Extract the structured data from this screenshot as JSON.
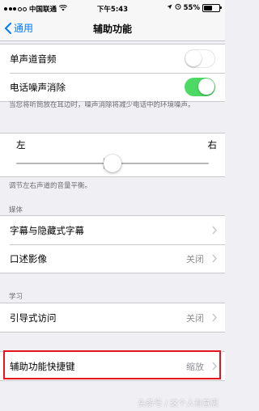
{
  "status_bar": {
    "carrier": "中国联通",
    "time": "下午5:43",
    "battery": "55%",
    "battery_level": 0.55,
    "icons": [
      "signal-dots-icon",
      "wifi-icon",
      "location-icon",
      "alarm-icon",
      "battery-icon"
    ]
  },
  "nav": {
    "back_label": "通用",
    "title": "辅助功能"
  },
  "audio_group": {
    "mono_audio_label": "单声道音频",
    "mono_audio_on": false,
    "noise_cancel_label": "电话噪声消除",
    "noise_cancel_on": true,
    "noise_cancel_footnote": "当您将听筒放在耳边时，噪声消除将减少电话中的环境噪声。"
  },
  "balance": {
    "left_label": "左",
    "right_label": "右",
    "value": 0.5,
    "footnote": "调节左右声道的音量平衡。"
  },
  "media_section": {
    "header": "媒体",
    "items": [
      {
        "label": "字幕与隐藏式字幕",
        "value": ""
      },
      {
        "label": "口述影像",
        "value": "关闭"
      }
    ]
  },
  "learning_section": {
    "header": "学习",
    "items": [
      {
        "label": "引导式访问",
        "value": "关闭"
      }
    ]
  },
  "shortcut": {
    "label": "辅助功能快捷键",
    "value": "缩放"
  },
  "watermark": "头条号 / 这个人有意思",
  "colors": {
    "accent": "#007aff",
    "toggle_on": "#4cd964",
    "highlight": "#e8141b",
    "background": "#efeff4"
  }
}
